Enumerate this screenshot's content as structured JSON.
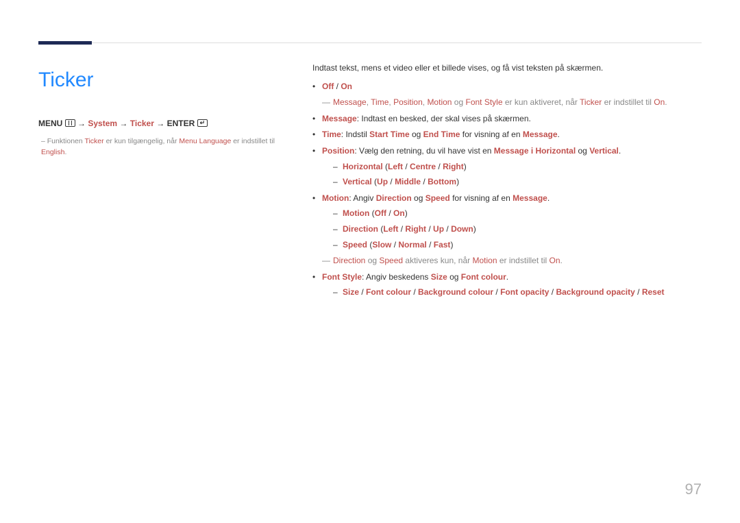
{
  "title": "Ticker",
  "menuPath": {
    "prefix": "MENU ",
    "sep": "→",
    "system": "System",
    "ticker": "Ticker",
    "enter": "ENTER "
  },
  "leftNote": {
    "t1": "Funktionen ",
    "ticker": "Ticker",
    "t2": " er kun tilgængelig, når ",
    "menuLang": "Menu Language",
    "t3": " er indstillet til ",
    "english": "English",
    "t4": "."
  },
  "intro": "Indtast tekst, mens et video eller et billede vises, og få vist teksten på skærmen.",
  "offOn": {
    "off": "Off",
    "sep": " / ",
    "on": "On"
  },
  "note1": {
    "message": "Message",
    "c1": ", ",
    "time": "Time",
    "c2": ", ",
    "position": "Position",
    "c3": ", ",
    "motion": "Motion",
    "og": " og ",
    "fontStyle": "Font Style",
    "mid": " er kun aktiveret, når ",
    "ticker": "Ticker",
    "tail": " er indstillet til ",
    "on": "On",
    "dot": "."
  },
  "messageLine": {
    "label": "Message",
    "text": ": Indtast en besked, der skal vises på skærmen."
  },
  "timeLine": {
    "label": "Time",
    "t1": ": Indstil ",
    "start": "Start Time",
    "og": " og ",
    "end": "End Time",
    "t2": " for visning af en ",
    "message": "Message",
    "dot": "."
  },
  "positionLine": {
    "label": "Position",
    "t1": ": Vælg den retning, du vil have vist en ",
    "messageI": "Message i ",
    "horizontal": "Horizontal",
    "og": " og ",
    "vertical": "Vertical",
    "dot": "."
  },
  "posSub1": {
    "horizontal": "Horizontal",
    "open": " (",
    "left": "Left",
    "s1": " / ",
    "centre": "Centre",
    "s2": " / ",
    "right": "Right",
    "close": ")"
  },
  "posSub2": {
    "vertical": "Vertical",
    "open": " (",
    "up": "Up",
    "s1": " / ",
    "middle": "Middle",
    "s2": " / ",
    "bottom": "Bottom",
    "close": ")"
  },
  "motionLine": {
    "label": "Motion",
    "t1": ": Angiv ",
    "direction": "Direction",
    "og": " og ",
    "speed": "Speed",
    "t2": " for visning af en ",
    "message": "Message",
    "dot": "."
  },
  "motionSub1": {
    "motion": "Motion",
    "open": " (",
    "off": "Off",
    "s1": " / ",
    "on": "On",
    "close": ")"
  },
  "motionSub2": {
    "direction": "Direction",
    "open": " (",
    "left": "Left",
    "s1": " / ",
    "right": "Right",
    "s2": " / ",
    "up": "Up",
    "s3": " / ",
    "down": "Down",
    "close": ")"
  },
  "motionSub3": {
    "speed": "Speed",
    "open": " (",
    "slow": "Slow",
    "s1": " / ",
    "normal": "Normal",
    "s2": " / ",
    "fast": "Fast",
    "close": ")"
  },
  "note2": {
    "direction": "Direction",
    "og": " og ",
    "speed": "Speed",
    "mid": " aktiveres kun, når ",
    "motion": "Motion",
    "tail": " er indstillet til ",
    "on": "On",
    "dot": "."
  },
  "fontStyleLine": {
    "label": "Font Style",
    "t1": ": Angiv beskedens ",
    "size": "Size",
    "og": " og ",
    "fontColour": "Font colour",
    "dot": "."
  },
  "fontSub": {
    "size": "Size",
    "s1": " / ",
    "fontColour": "Font colour",
    "s2": " / ",
    "bgColour": "Background colour",
    "s3": " / ",
    "fontOpacity": "Font opacity",
    "s4": " / ",
    "bgOpacity": "Background opacity",
    "s5": " / ",
    "reset": "Reset"
  },
  "pageNumber": "97"
}
